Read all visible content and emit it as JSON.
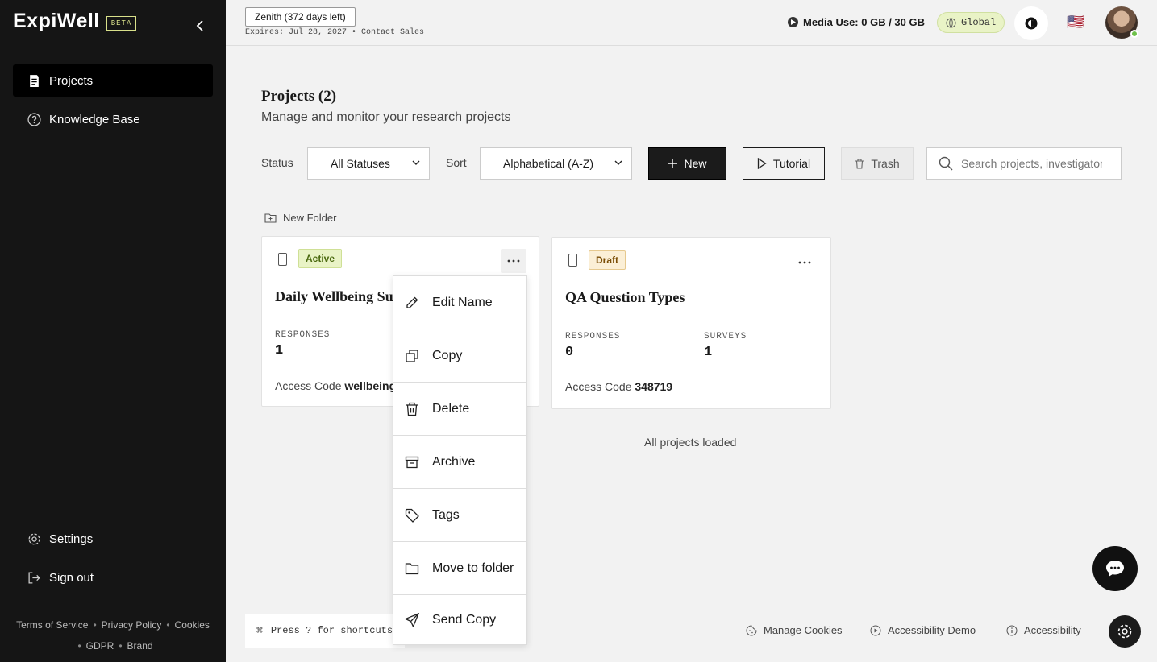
{
  "app": {
    "logo": "ExpiWell",
    "beta_label": "BETA"
  },
  "sidebar": {
    "items": [
      {
        "label": "Projects",
        "active": true
      },
      {
        "label": "Knowledge Base",
        "active": false
      }
    ],
    "bottom_items": [
      {
        "label": "Settings"
      },
      {
        "label": "Sign out"
      }
    ],
    "footer_links": [
      "Terms of Service",
      "Privacy Policy",
      "Cookies",
      "GDPR",
      "Brand"
    ]
  },
  "topbar": {
    "plan": "Zenith (372 days left)",
    "expires": "Expires: Jul 28, 2027 • Contact Sales",
    "media_use": "Media Use: 0 GB / 30 GB",
    "region": "Global",
    "flag": "🇺🇸"
  },
  "main": {
    "title": "Projects (2)",
    "subtitle": "Manage and monitor your research projects",
    "status_label": "Status",
    "status_value": "All Statuses",
    "sort_label": "Sort",
    "sort_value": "Alphabetical (A-Z)",
    "new_button": "New",
    "tutorial_button": "Tutorial",
    "trash_button": "Trash",
    "search_placeholder": "Search projects, investigators...",
    "new_folder": "New Folder",
    "loaded_text": "All projects loaded"
  },
  "projects": [
    {
      "status": "Active",
      "title": "Daily Wellbeing Survey",
      "responses_label": "RESPONSES",
      "responses": "1",
      "access_label": "Access Code",
      "access_code": "wellbeing"
    },
    {
      "status": "Draft",
      "title": "QA Question Types",
      "responses_label": "RESPONSES",
      "responses": "0",
      "surveys_label": "SURVEYS",
      "surveys": "1",
      "access_label": "Access Code",
      "access_code": "348719"
    }
  ],
  "context_menu": {
    "items": [
      {
        "label": "Edit Name",
        "icon": "pencil-icon"
      },
      {
        "label": "Copy",
        "icon": "copy-icon"
      },
      {
        "label": "Delete",
        "icon": "trash-icon"
      },
      {
        "label": "Archive",
        "icon": "archive-icon"
      },
      {
        "label": "Tags",
        "icon": "tag-icon"
      },
      {
        "label": "Move to folder",
        "icon": "folder-icon"
      },
      {
        "label": "Send Copy",
        "icon": "send-icon"
      }
    ]
  },
  "footer": {
    "shortcut_hint": "Press ? for shortcuts",
    "manage_cookies": "Manage Cookies",
    "accessibility_demo": "Accessibility Demo",
    "accessibility": "Accessibility"
  }
}
